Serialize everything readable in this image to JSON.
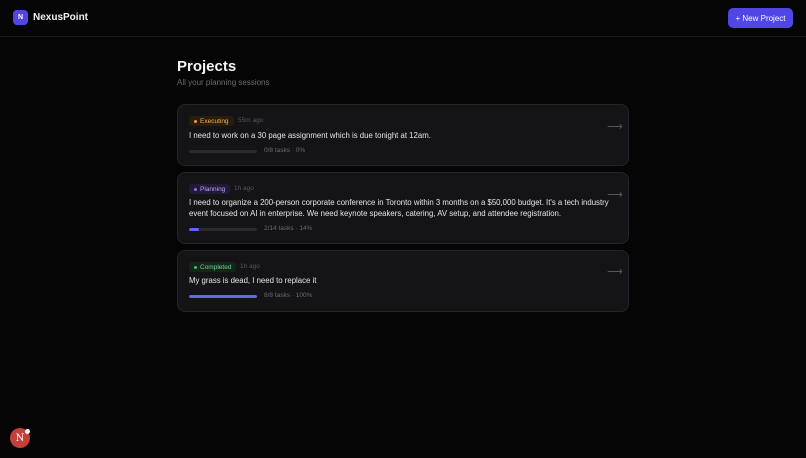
{
  "app": {
    "logo_letter": "N",
    "name": "NexusPoint",
    "new_project_label": "+ New Project"
  },
  "page": {
    "title": "Projects",
    "subtitle": "All your planning sessions"
  },
  "projects": [
    {
      "status": "Executing",
      "time": "55m ago",
      "description": "I need to work on a 30 page assignment which is due tonight at 12am.",
      "progress_text": "0/8 tasks · 0%",
      "progress": 0.0
    },
    {
      "status": "Planning",
      "time": "1h ago",
      "description": "I need to organize a 200-person corporate conference in Toronto within 3 months on a $50,000 budget. It's a tech industry event focused on AI in enterprise. We need keynote speakers, catering, AV setup, and attendee registration.",
      "progress_text": "2/14 tasks · 14%",
      "progress": 0.14
    },
    {
      "status": "Completed",
      "time": "1h ago",
      "description": "My grass is dead, I need to replace it",
      "progress_text": "8/8 tasks · 100%",
      "progress": 1.0
    }
  ],
  "icons": {
    "arrow": "arrow-right-icon",
    "arrow_glyph": "⟶"
  },
  "user": {
    "avatar_letter": "N"
  },
  "colors": {
    "accent": "#4f46e5",
    "executing": "#f29b38",
    "planning": "#8b6cf0",
    "completed": "#3ec06f"
  }
}
